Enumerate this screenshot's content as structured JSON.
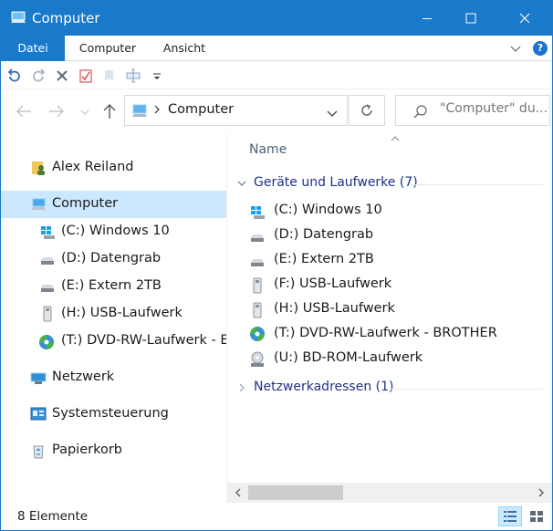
{
  "window": {
    "title": "Computer",
    "controls": {
      "minimize": "minimize",
      "maximize": "maximize",
      "close": "close"
    }
  },
  "ribbon": {
    "tabs": [
      {
        "label": "Datei",
        "active": true
      },
      {
        "label": "Computer",
        "active": false
      },
      {
        "label": "Ansicht",
        "active": false
      }
    ]
  },
  "address": {
    "path": "Computer",
    "search_placeholder": "\"Computer\" du..."
  },
  "nav_pane": {
    "items": [
      {
        "label": "Alex Reiland",
        "icon": "user-folder-icon"
      },
      {
        "label": "Computer",
        "icon": "computer-icon",
        "selected": true
      },
      {
        "label": "(C:) Windows 10",
        "icon": "windows-drive-icon"
      },
      {
        "label": "(D:) Datengrab",
        "icon": "hard-drive-icon"
      },
      {
        "label": "(E:) Extern 2TB",
        "icon": "hard-drive-icon"
      },
      {
        "label": "(H:) USB-Laufwerk",
        "icon": "usb-drive-icon"
      },
      {
        "label": "(T:) DVD-RW-Laufwerk - BROTHER",
        "icon": "dvd-drive-icon"
      },
      {
        "label": "Netzwerk",
        "icon": "network-icon"
      },
      {
        "label": "Systemsteuerung",
        "icon": "control-panel-icon"
      },
      {
        "label": "Papierkorb",
        "icon": "recycle-bin-icon"
      }
    ]
  },
  "content": {
    "column_header": "Name",
    "groups": [
      {
        "title": "Geräte und Laufwerke (7)",
        "expanded": true,
        "items": [
          {
            "label": "(C:) Windows 10",
            "icon": "windows-drive-icon"
          },
          {
            "label": "(D:) Datengrab",
            "icon": "hard-drive-icon"
          },
          {
            "label": "(E:) Extern 2TB",
            "icon": "hard-drive-icon"
          },
          {
            "label": "(F:) USB-Laufwerk",
            "icon": "usb-drive-icon"
          },
          {
            "label": "(H:) USB-Laufwerk",
            "icon": "usb-drive-icon"
          },
          {
            "label": "(T:) DVD-RW-Laufwerk - BROTHER",
            "icon": "dvd-drive-icon"
          },
          {
            "label": "(U:) BD-ROM-Laufwerk",
            "icon": "bd-drive-icon"
          }
        ]
      },
      {
        "title": "Netzwerkadressen (1)",
        "expanded": false,
        "items": []
      }
    ]
  },
  "status_bar": {
    "item_count": "8 Elemente"
  },
  "colors": {
    "accent": "#1979ca",
    "selection": "#cce8ff",
    "group_title": "#1e3287",
    "column_header": "#4c607a"
  }
}
